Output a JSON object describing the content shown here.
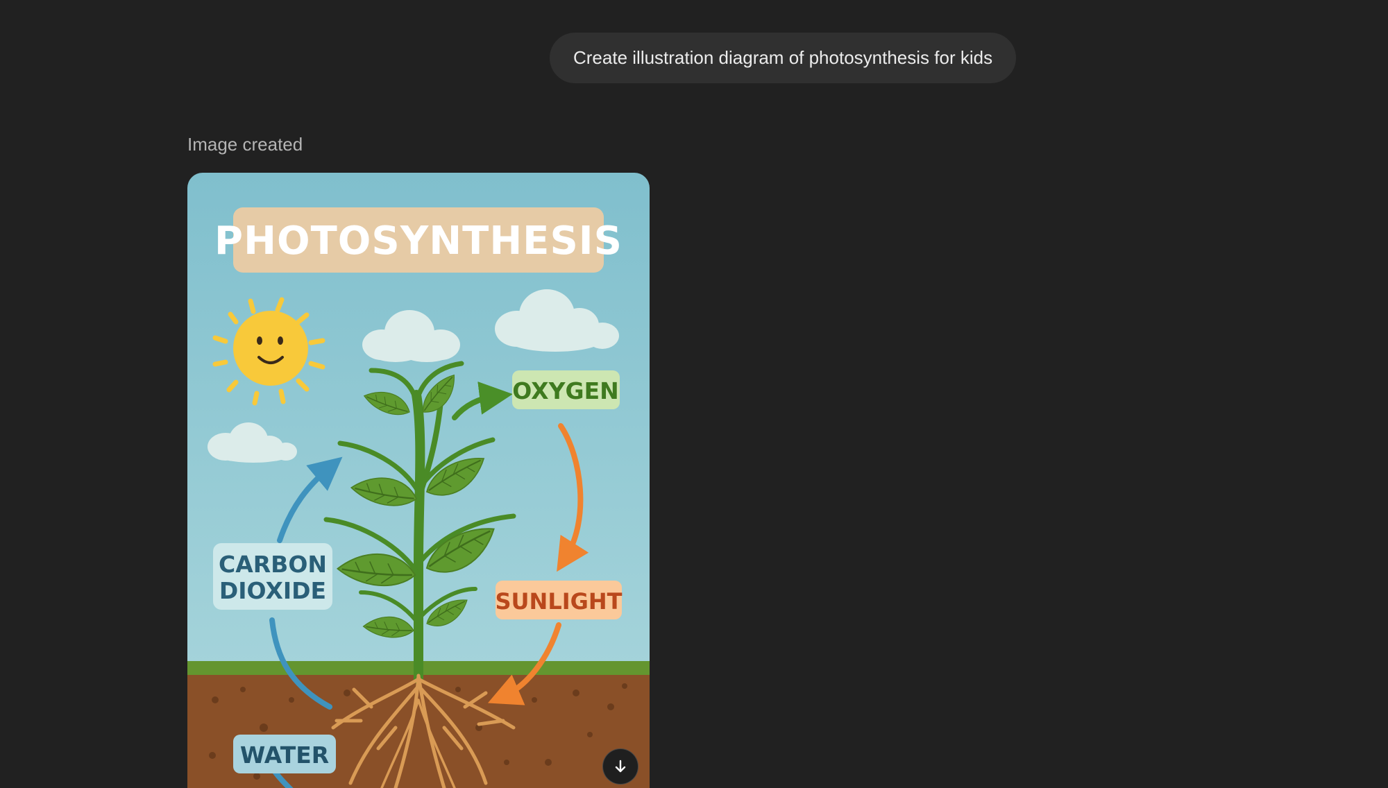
{
  "conversation": {
    "user_message": "Create illustration diagram of photosynthesis for kids",
    "assistant_status": "Image created"
  },
  "illustration": {
    "title": "PHOTOSYNTHESIS",
    "labels": {
      "oxygen": "OXYGEN",
      "carbon_line1": "CARBON",
      "carbon_line2": "DIOXIDE",
      "sunlight": "SUNLIGHT",
      "water": "WATER"
    },
    "colors": {
      "sky": "#8cc6d2",
      "title_box": "#e6cba6",
      "sun": "#f8c93a",
      "leaf": "#5f9a2f",
      "soil": "#8a5028",
      "grass": "#64952f",
      "root": "#d99b55",
      "arrow_blue": "#3f93be",
      "arrow_orange": "#f0832f",
      "arrow_green": "#4a8f28"
    }
  },
  "actions": {
    "download_icon": "arrow-down-icon"
  }
}
